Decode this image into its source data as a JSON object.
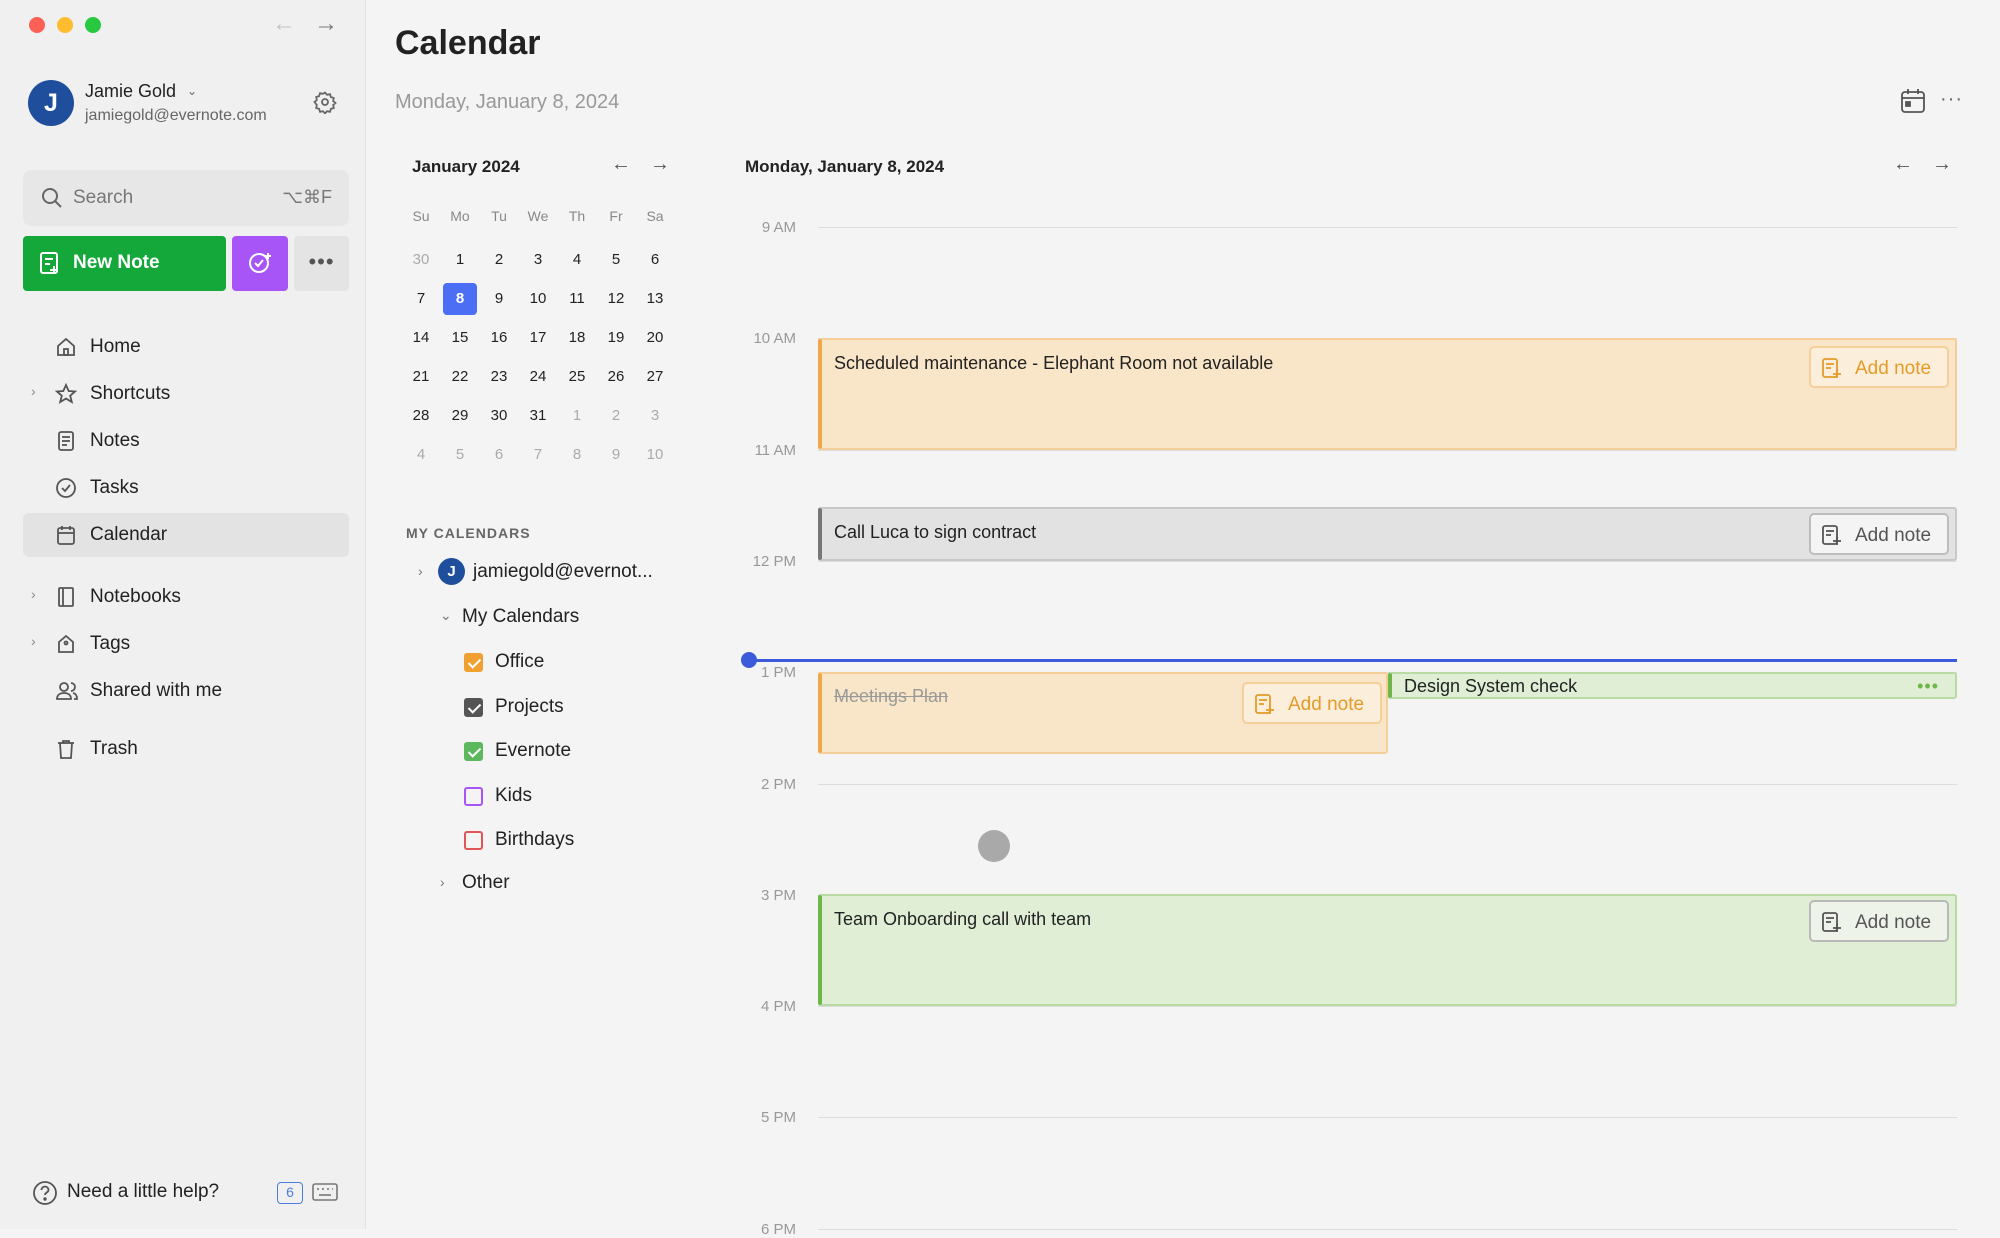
{
  "sidebar": {
    "user": {
      "initial": "J",
      "name": "Jamie Gold",
      "email": "jamiegold@evernote.com"
    },
    "search": {
      "placeholder": "Search",
      "shortcut": "⌥⌘F"
    },
    "new_note_label": "New Note",
    "more_label": "•••",
    "nav": {
      "home": "Home",
      "shortcuts": "Shortcuts",
      "notes": "Notes",
      "tasks": "Tasks",
      "calendar": "Calendar",
      "notebooks": "Notebooks",
      "tags": "Tags",
      "shared": "Shared with me",
      "trash": "Trash"
    },
    "help_label": "Need a little help?",
    "help_badge": "6"
  },
  "header": {
    "title": "Calendar",
    "subtitle": "Monday, January 8, 2024",
    "more_label": "···"
  },
  "mini_calendar": {
    "month_label": "January 2024",
    "weekdays": [
      "Su",
      "Mo",
      "Tu",
      "We",
      "Th",
      "Fr",
      "Sa"
    ],
    "weeks": [
      [
        "30",
        "1",
        "2",
        "3",
        "4",
        "5",
        "6"
      ],
      [
        "7",
        "8",
        "9",
        "10",
        "11",
        "12",
        "13"
      ],
      [
        "14",
        "15",
        "16",
        "17",
        "18",
        "19",
        "20"
      ],
      [
        "21",
        "22",
        "23",
        "24",
        "25",
        "26",
        "27"
      ],
      [
        "28",
        "29",
        "30",
        "31",
        "1",
        "2",
        "3"
      ],
      [
        "4",
        "5",
        "6",
        "7",
        "8",
        "9",
        "10"
      ]
    ],
    "selected_day": "8"
  },
  "my_calendars": {
    "heading": "MY CALENDARS",
    "account_initial": "J",
    "account_label": "jamiegold@evernot...",
    "group_label": "My Calendars",
    "calendars": [
      {
        "name": "Office",
        "checked": true,
        "color": "#f0a030"
      },
      {
        "name": "Projects",
        "checked": true,
        "color": "#555555"
      },
      {
        "name": "Evernote",
        "checked": true,
        "color": "#5cb85c"
      },
      {
        "name": "Kids",
        "checked": false,
        "color": "#a855f7"
      },
      {
        "name": "Birthdays",
        "checked": false,
        "color": "#e05555"
      }
    ],
    "other_label": "Other"
  },
  "day_view": {
    "title": "Monday, January 8, 2024",
    "hours": [
      "9 AM",
      "10 AM",
      "11 AM",
      "12 PM",
      "1 PM",
      "2 PM",
      "3 PM",
      "4 PM",
      "5 PM",
      "6 PM"
    ],
    "add_note_label": "Add note",
    "events": {
      "maintenance": "Scheduled maintenance - Elephant Room not available",
      "call_luca": "Call Luca to sign contract",
      "meetings_plan": "Meetings Plan",
      "design_check": "Design System check",
      "onboarding": "Team Onboarding call with team"
    },
    "design_more": "•••"
  },
  "colors": {
    "accent_green": "#14a83b",
    "accent_purple": "#a855f7",
    "today_blue": "#4c6ef5",
    "now_line": "#3b5bdb"
  }
}
